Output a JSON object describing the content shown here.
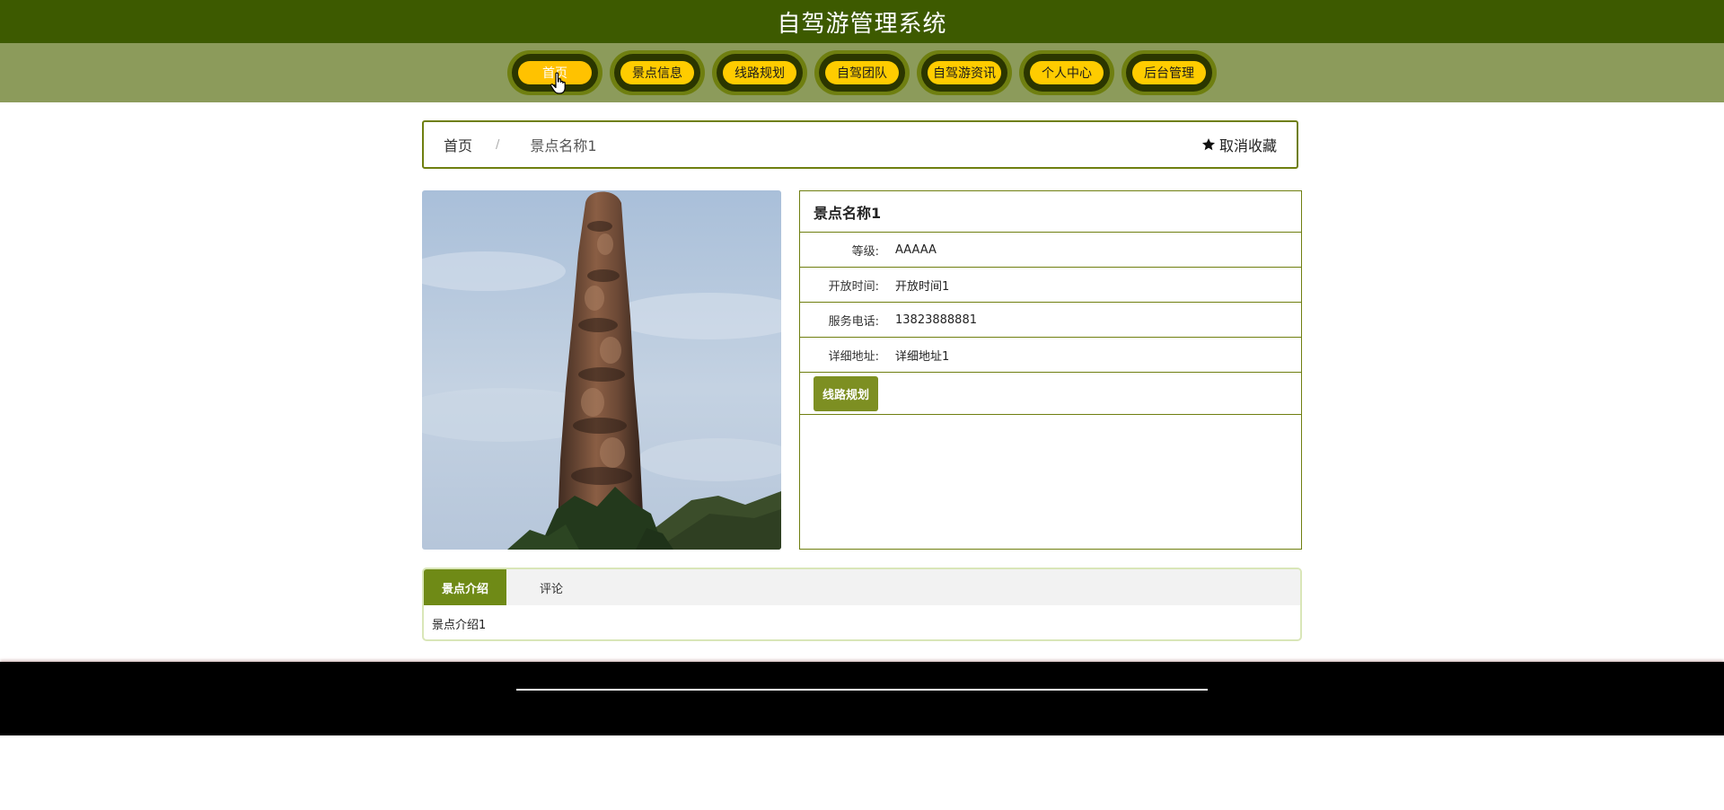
{
  "header": {
    "title": "自驾游管理系统"
  },
  "nav": {
    "items": [
      {
        "label": "首页"
      },
      {
        "label": "景点信息"
      },
      {
        "label": "线路规划"
      },
      {
        "label": "自驾团队"
      },
      {
        "label": "自驾游资讯"
      },
      {
        "label": "个人中心"
      },
      {
        "label": "后台管理"
      }
    ],
    "active_index": 0,
    "accent_color": "#ffcc00",
    "bar_color": "#3d5a00"
  },
  "breadcrumb": {
    "home": "首页",
    "separator": "/",
    "current": "景点名称1"
  },
  "favorite": {
    "icon": "star-icon",
    "label": "取消收藏"
  },
  "detail": {
    "name": "景点名称1",
    "fields": [
      {
        "label": "等级:",
        "value": "AAAAA"
      },
      {
        "label": "开放时间:",
        "value": "开放时间1"
      },
      {
        "label": "服务电话:",
        "value": "13823888881"
      },
      {
        "label": "详细地址:",
        "value": "详细地址1"
      }
    ],
    "action_label": "线路规划"
  },
  "tabs": {
    "items": [
      {
        "label": "景点介绍"
      },
      {
        "label": "评论"
      }
    ],
    "active_index": 0,
    "content": "景点介绍1"
  }
}
